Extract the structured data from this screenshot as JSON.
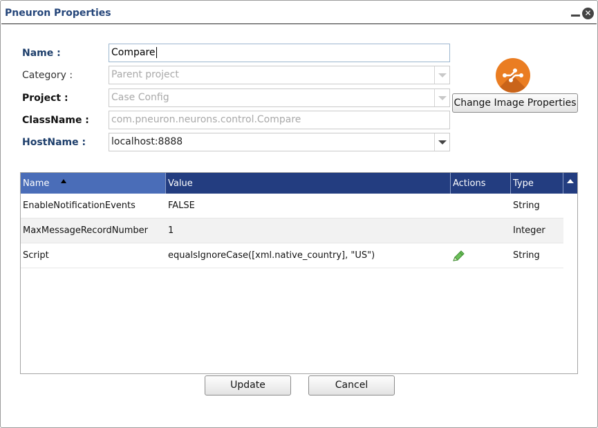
{
  "window": {
    "title": "Pneuron Properties",
    "minimize_icon": "minimize-icon",
    "close_icon": "close-icon"
  },
  "form": {
    "name": {
      "label": "Name :",
      "value": "Compare"
    },
    "category": {
      "label": "Category :",
      "placeholder": "Parent project"
    },
    "project": {
      "label": "Project :",
      "value": "Case Config"
    },
    "classname": {
      "label": "ClassName :",
      "value": "com.pneuron.neurons.control.Compare"
    },
    "hostname": {
      "label": "HostName :",
      "value": "localhost:8888"
    }
  },
  "image": {
    "logo_icon": "pneuron-logo-icon",
    "logo_color": "#ea7d22",
    "change_button": "Change Image Properties"
  },
  "grid": {
    "columns": [
      "Name",
      "Value",
      "Actions",
      "Type"
    ],
    "sorted_column": "Name",
    "sort_direction": "ascending",
    "header_color": "#233d80",
    "rows": [
      {
        "name": "EnableNotificationEvents",
        "value": "FALSE",
        "action_icon": "",
        "type": "String"
      },
      {
        "name": "MaxMessageRecordNumber",
        "value": "1",
        "action_icon": "",
        "type": "Integer"
      },
      {
        "name": "Script",
        "value": "equalsIgnoreCase([xml.native_country], \"US\")",
        "action_icon": "pencil-edit-icon",
        "type": "String"
      }
    ]
  },
  "buttons": {
    "update": "Update",
    "cancel": "Cancel"
  }
}
